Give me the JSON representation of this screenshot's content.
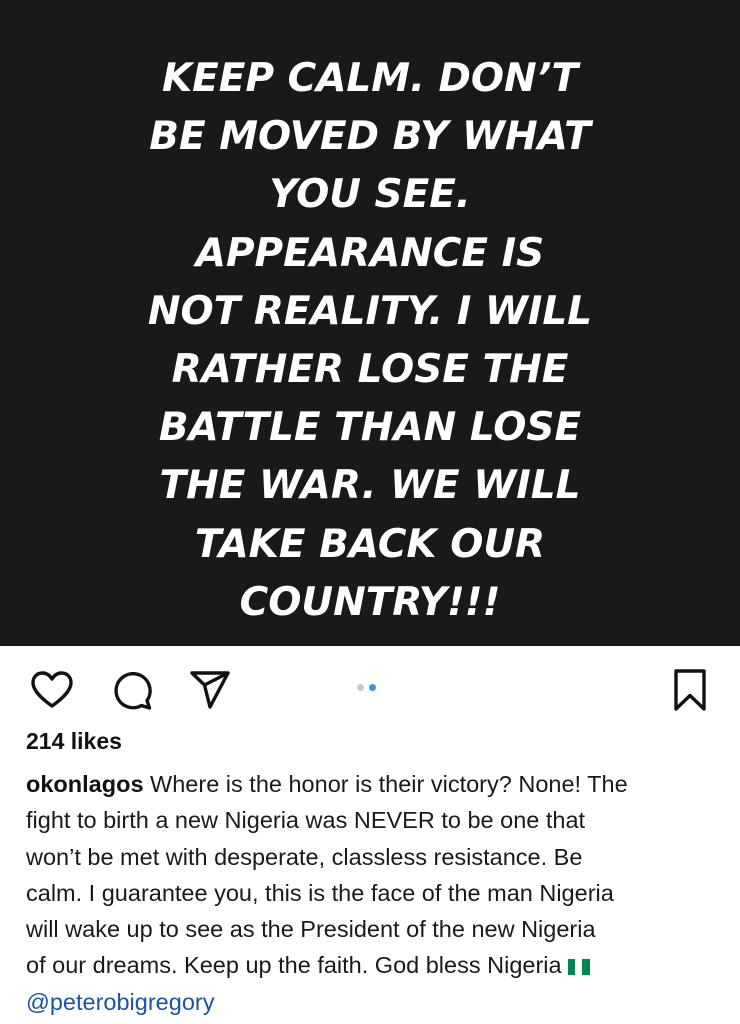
{
  "post": {
    "image_text_lines": [
      "KEEP CALM. DON’T",
      "BE MOVED BY WHAT",
      "YOU SEE.",
      "APPEARANCE IS",
      "NOT REALITY. I WILL",
      "RATHER LOSE THE",
      "BATTLE THAN LOSE",
      "THE WAR. WE WILL",
      "TAKE BACK OUR",
      "COUNTRY!!!"
    ],
    "carousel": {
      "count": 2,
      "active_index": 1
    },
    "likes": "214 likes",
    "caption": {
      "username": "okonlagos",
      "first_line_text": " Where is the honor is their victory? None! The",
      "lines": [
        "fight to birth a new Nigeria was NEVER to be one that",
        "won’t be met with desperate, classless resistance. Be",
        "calm. I guarantee you, this is the face of the man Nigeria",
        "will wake up to see as the President of the new Nigeria",
        "of our dreams. Keep up the faith. God bless Nigeria"
      ],
      "flag_icon": "nigeria-flag-icon",
      "mention": "@peterobigregory"
    }
  },
  "icons": {
    "like": "heart-icon",
    "comment": "comment-bubble-icon",
    "share": "paper-plane-icon",
    "save": "bookmark-icon"
  },
  "colors": {
    "image_background": "#191919",
    "image_text": "#ffffff",
    "accent_blue": "#3897f0",
    "inactive_dot": "#c7c7c7",
    "mention": "#1a53a8",
    "flag_green": "#008751",
    "flag_white": "#ffffff"
  }
}
